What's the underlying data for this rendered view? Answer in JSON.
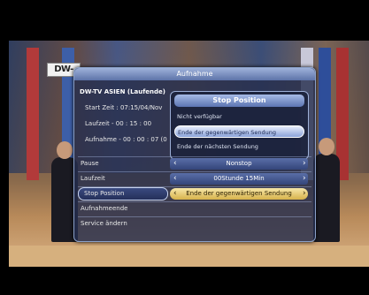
{
  "logo": {
    "text": "DW-"
  },
  "osd": {
    "title": "Aufnahme",
    "info": {
      "channel": "DW-TV ASIEN (Laufende)",
      "start_label": "Start Zeit",
      "start_value": "07:15/04/Nov",
      "duration_label": "Laufzeit",
      "duration_value": "00 : 15 : 00",
      "recording_label": "Aufnahme",
      "recording_value": "00 : 00 : 07 (0"
    },
    "popup": {
      "title": "Stop Position",
      "options": [
        {
          "label": "Nicht verfügbar",
          "selected": false
        },
        {
          "label": "Ende der gegenwärtigen Sendung",
          "selected": true
        },
        {
          "label": "Ende der nächsten Sendung",
          "selected": false
        }
      ]
    },
    "rows": [
      {
        "label": "Pause",
        "value": "Nonstop"
      },
      {
        "label": "Laufzeit",
        "value": "00Stunde 15Min"
      },
      {
        "label": "Stop Position",
        "value": "Ende der gegenwärtigen Sendung"
      },
      {
        "label": "Aufnahmeende",
        "value": ""
      },
      {
        "label": "Service ändern",
        "value": ""
      }
    ]
  },
  "colors": {
    "highlight": "#d6b24a",
    "menu_bg": "#262e4e",
    "accent": "#5c75b2"
  }
}
